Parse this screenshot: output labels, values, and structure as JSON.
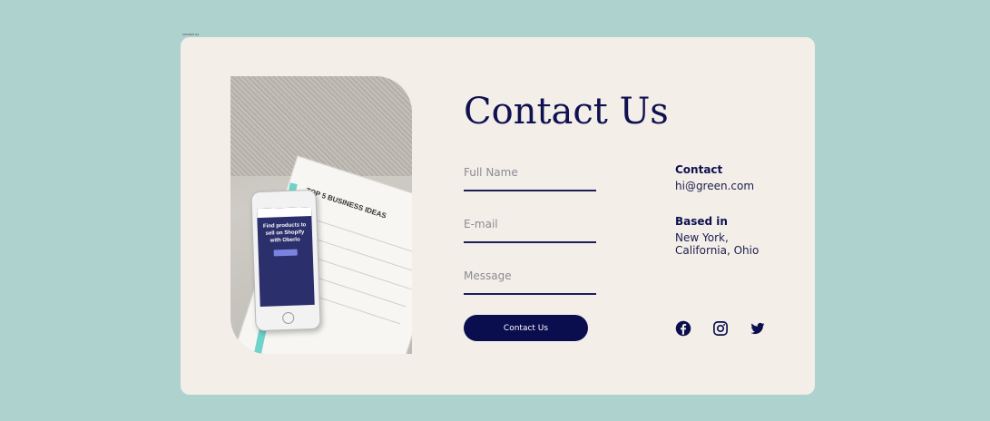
{
  "frame_label": "contact us",
  "heading": "Contact Us",
  "form": {
    "full_name_placeholder": "Full Name",
    "email_placeholder": "E-mail",
    "message_placeholder": "Message",
    "submit_label": "Contact Us"
  },
  "info": {
    "contact_label": "Contact",
    "contact_value": "hi@green.com",
    "based_label": "Based in",
    "based_value_line1": "New York,",
    "based_value_line2": "California, Ohio"
  },
  "social": [
    "facebook-icon",
    "instagram-icon",
    "twitter-icon"
  ],
  "photo": {
    "notebook_title": "TOP 5 BUSINESS IDEAS",
    "phone_text": "Find products to sell on Shopify with Oberlo"
  },
  "colors": {
    "background": "#aed3cf",
    "card": "#f3eee8",
    "primary": "#0a0d4e"
  }
}
